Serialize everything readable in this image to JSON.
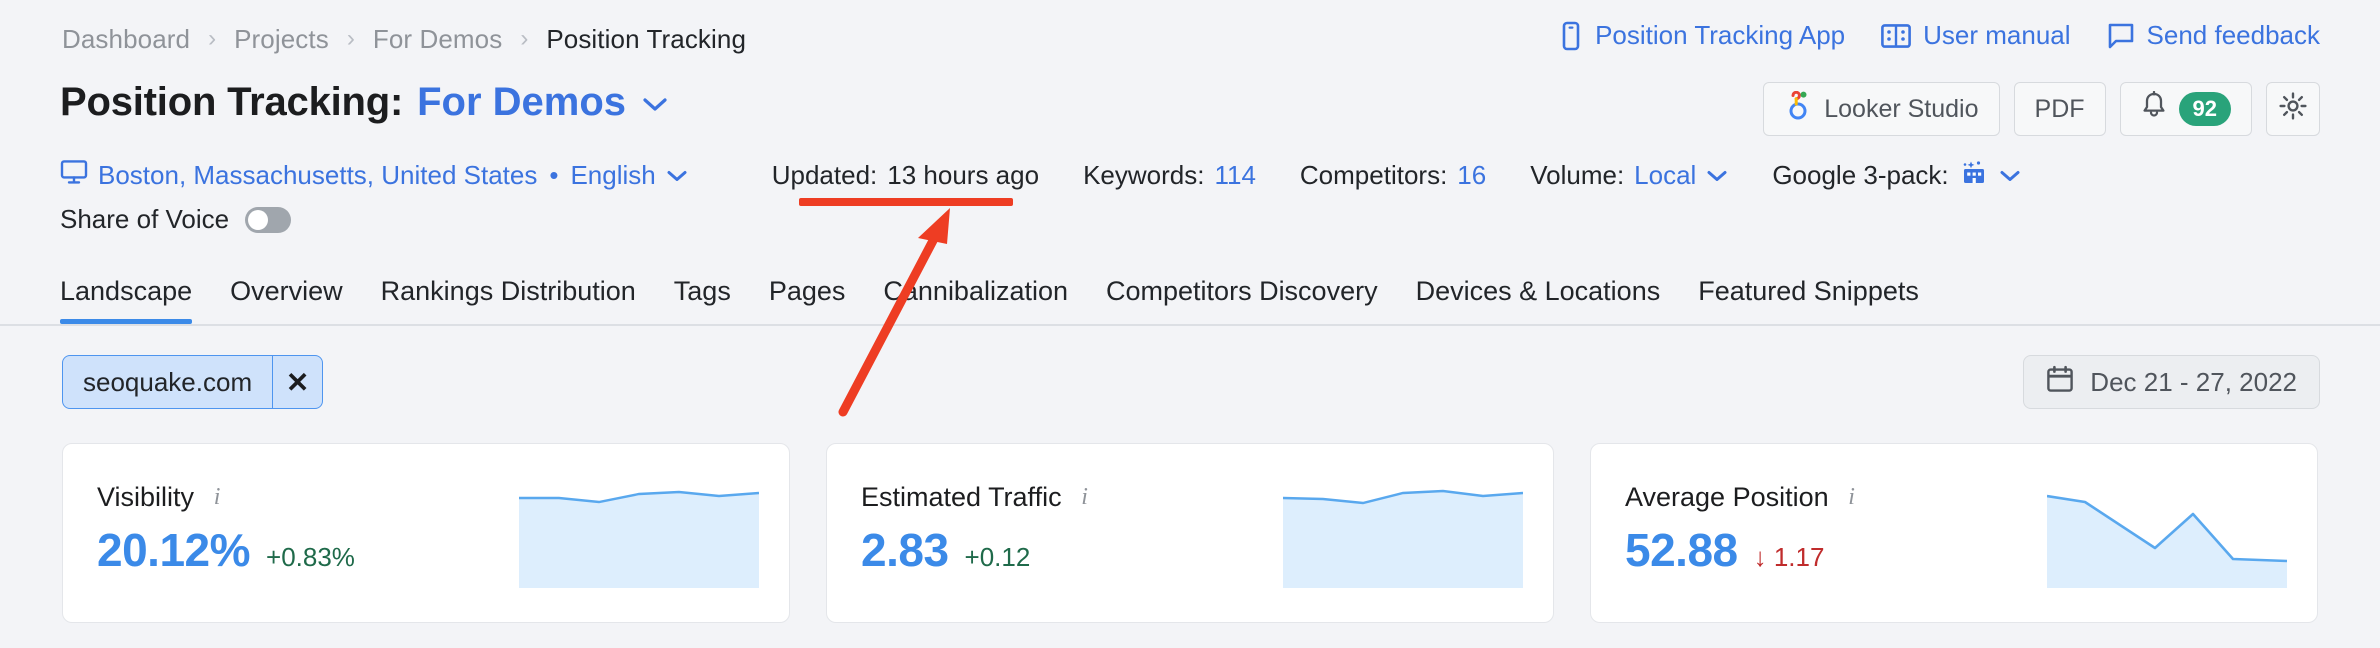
{
  "breadcrumb": {
    "items": [
      {
        "label": "Dashboard"
      },
      {
        "label": "Projects"
      },
      {
        "label": "For Demos"
      },
      {
        "label": "Position Tracking"
      }
    ],
    "separator": "›"
  },
  "top_links": [
    {
      "label": "Position Tracking App",
      "icon": "mobile-app-icon"
    },
    {
      "label": "User manual",
      "icon": "book-icon"
    },
    {
      "label": "Send feedback",
      "icon": "chat-bubble-icon"
    }
  ],
  "title": {
    "prefix": "Position Tracking:",
    "project": "For Demos",
    "caret": "⌄"
  },
  "title_actions": {
    "looker_label": "Looker Studio",
    "pdf_label": "PDF",
    "notifications_count": "92",
    "settings_icon": "gear-icon"
  },
  "meta": {
    "location": "Boston, Massachusetts, United States",
    "separator_dot": "•",
    "language": "English",
    "updated_label": "Updated:",
    "updated_value": "13 hours ago",
    "keywords_label": "Keywords:",
    "keywords_value": "114",
    "competitors_label": "Competitors:",
    "competitors_value": "16",
    "volume_label": "Volume:",
    "volume_value": "Local",
    "google3pack_label": "Google 3-pack:",
    "share_of_voice_label": "Share of Voice",
    "share_of_voice_on": false
  },
  "tabs": [
    {
      "label": "Landscape",
      "active": true
    },
    {
      "label": "Overview",
      "active": false
    },
    {
      "label": "Rankings Distribution",
      "active": false
    },
    {
      "label": "Tags",
      "active": false
    },
    {
      "label": "Pages",
      "active": false
    },
    {
      "label": "Cannibalization",
      "active": false
    },
    {
      "label": "Competitors Discovery",
      "active": false
    },
    {
      "label": "Devices & Locations",
      "active": false
    },
    {
      "label": "Featured Snippets",
      "active": false
    }
  ],
  "filters": {
    "domain_chip": "seoquake.com",
    "chip_close": "✕",
    "date_range": "Dec 21 - 27, 2022"
  },
  "cards": [
    {
      "title": "Visibility",
      "value": "20.12%",
      "delta": "+0.83%",
      "delta_direction": "up"
    },
    {
      "title": "Estimated Traffic",
      "value": "2.83",
      "delta": "+0.12",
      "delta_direction": "up"
    },
    {
      "title": "Average Position",
      "value": "52.88",
      "delta": "↓ 1.17",
      "delta_direction": "down"
    }
  ],
  "chart_data": [
    {
      "type": "area",
      "title": "Visibility",
      "x": [
        0,
        1,
        2,
        3,
        4,
        5,
        6
      ],
      "values": [
        20.0,
        20.0,
        19.9,
        20.15,
        20.2,
        20.1,
        20.12
      ],
      "ylim": [
        19.5,
        20.6
      ],
      "grid": false,
      "legend": "none"
    },
    {
      "type": "area",
      "title": "Estimated Traffic",
      "x": [
        0,
        1,
        2,
        3,
        4,
        5,
        6
      ],
      "values": [
        2.76,
        2.76,
        2.74,
        2.83,
        2.86,
        2.82,
        2.83
      ],
      "ylim": [
        2.5,
        3.0
      ],
      "grid": false,
      "legend": "none"
    },
    {
      "type": "area",
      "title": "Average Position",
      "x": [
        0,
        1,
        2,
        3,
        4,
        5,
        6
      ],
      "values": [
        54.05,
        53.9,
        52.2,
        51.2,
        53.0,
        51.7,
        51.65
      ],
      "ylim": [
        50.5,
        54.5
      ],
      "grid": false,
      "legend": "none"
    }
  ],
  "colors": {
    "accent_blue": "#3b73df",
    "value_blue": "#3b8ae8",
    "annotation_red": "#ee3d23",
    "delta_up_green": "#1f6a4a",
    "delta_down_red": "#c02c2c",
    "badge_green": "#29a37a",
    "page_bg": "#f3f4f7"
  }
}
